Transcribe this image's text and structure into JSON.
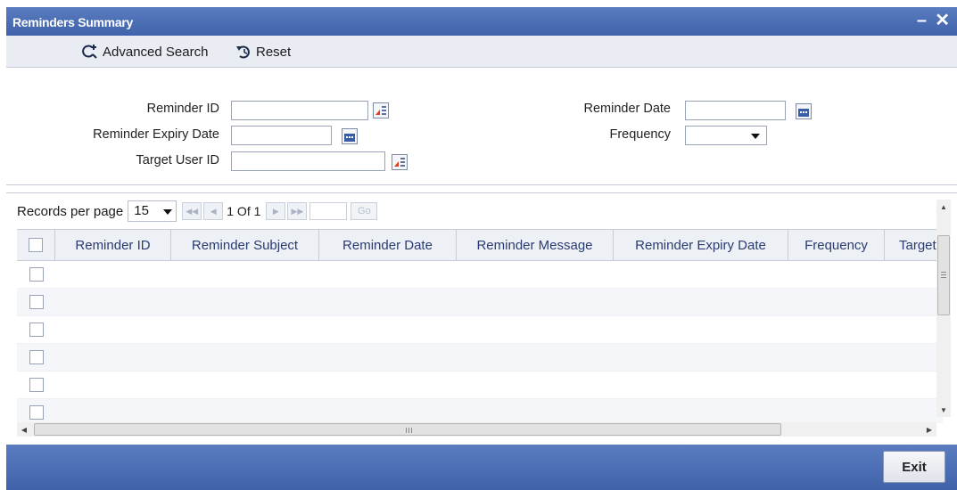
{
  "window": {
    "title": "Reminders Summary",
    "minimize_glyph": "–",
    "close_glyph": "✕"
  },
  "toolbar": {
    "advanced_search_label": "Advanced Search",
    "reset_label": "Reset"
  },
  "criteria": {
    "reminder_id_label": "Reminder ID",
    "reminder_id_value": "",
    "reminder_expiry_date_label": "Reminder Expiry Date",
    "reminder_expiry_date_value": "",
    "target_user_id_label": "Target User ID",
    "target_user_id_value": "",
    "reminder_date_label": "Reminder Date",
    "reminder_date_value": "",
    "frequency_label": "Frequency",
    "frequency_value": ""
  },
  "pager": {
    "records_per_page_label": "Records per page",
    "records_per_page_value": "15",
    "page_info": "1 Of 1",
    "go_label": "Go"
  },
  "grid": {
    "columns": [
      "Reminder ID",
      "Reminder Subject",
      "Reminder Date",
      "Reminder Message",
      "Reminder Expiry Date",
      "Frequency",
      "Target User ID"
    ],
    "empty_rows": 6
  },
  "footer": {
    "exit_label": "Exit"
  },
  "colors": {
    "title_bar": "#4a6db5",
    "toolbar_bg": "#e9edf3",
    "grid_header_text": "#2a3c70",
    "lookup_icon_accent": "#e0401a"
  },
  "icons": {
    "advanced_search": "advanced-search-icon",
    "reset": "reset-icon",
    "lookup": "lookup-list-icon",
    "calendar": "calendar-icon"
  }
}
